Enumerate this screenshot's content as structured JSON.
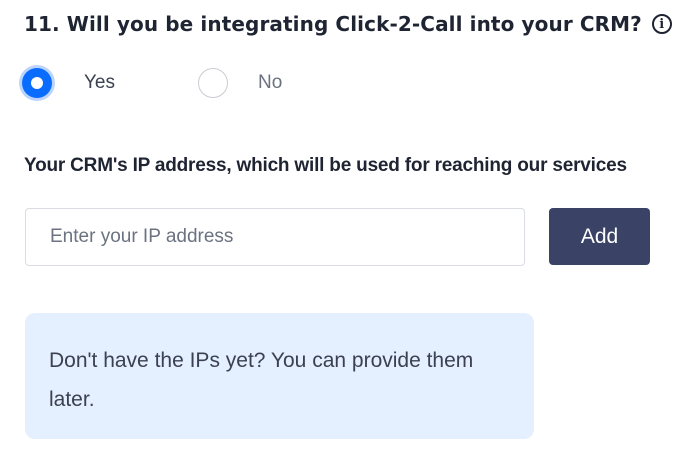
{
  "question": {
    "text": "11. Will you be integrating Click-2-Call into your CRM?",
    "info_icon": "info-circle-icon",
    "info_glyph": "i"
  },
  "radio": {
    "options": [
      {
        "label": "Yes",
        "checked": true
      },
      {
        "label": "No",
        "checked": false
      }
    ],
    "accent_color": "#0a6cff"
  },
  "ip_field": {
    "label": "Your CRM's IP address, which will be used for reaching our services",
    "placeholder": "Enter your IP address",
    "value": ""
  },
  "add_button": {
    "label": "Add",
    "color": "#3a4266"
  },
  "note": {
    "text": "Don't have the IPs yet? You can provide them later.",
    "background": "#e4efff"
  }
}
